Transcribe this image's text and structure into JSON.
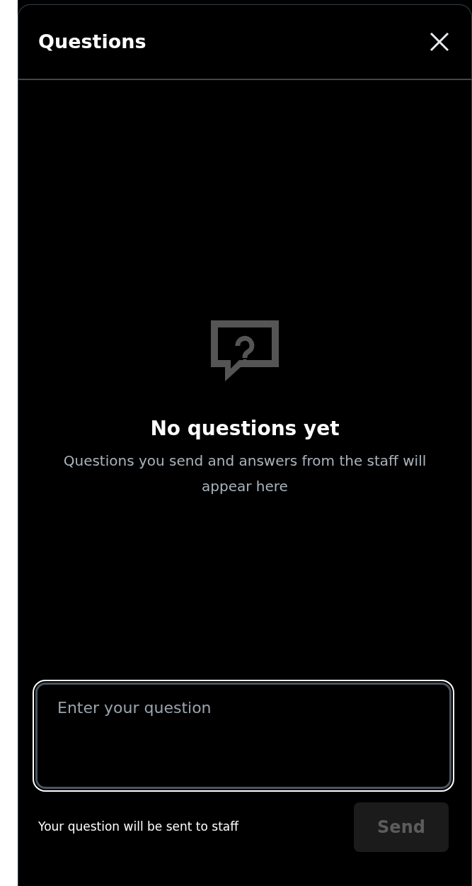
{
  "panel": {
    "title": "Questions"
  },
  "empty_state": {
    "title": "No questions yet",
    "message": "Questions you send and answers from the staff will appear here"
  },
  "question_field": {
    "placeholder": "Enter your question",
    "focused": true
  },
  "footer": {
    "note": "Your question will be sent to staff"
  },
  "send_button": {
    "label": "Send",
    "disabled": true
  }
}
